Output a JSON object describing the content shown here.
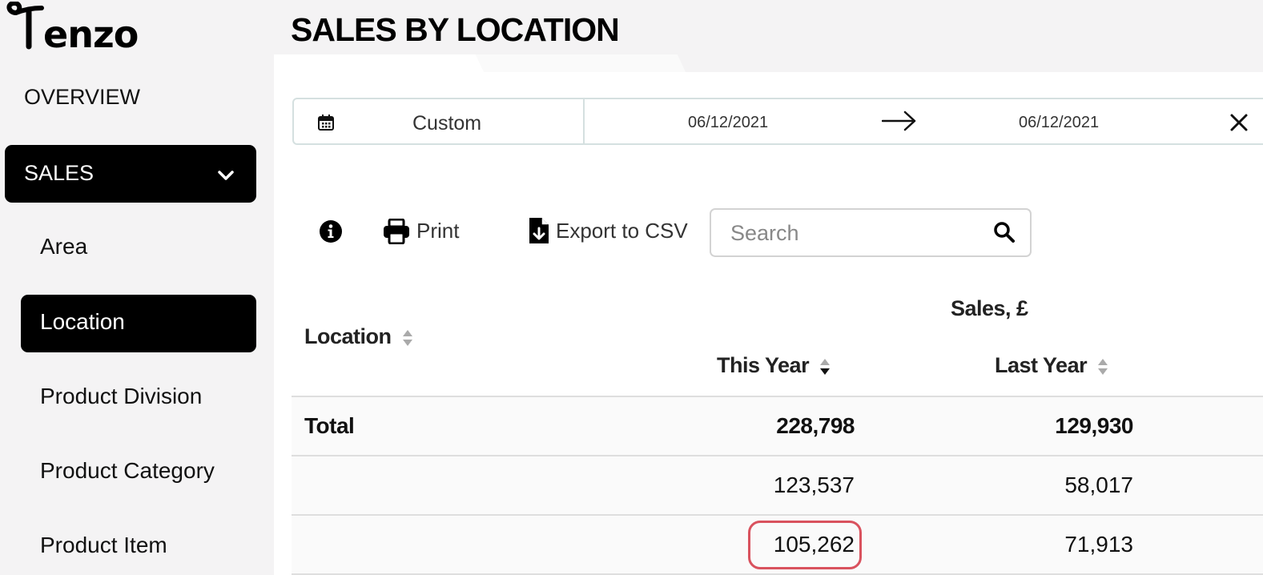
{
  "brand": {
    "logo_text": "Tenzo"
  },
  "page": {
    "title": "SALES BY LOCATION"
  },
  "sidebar": {
    "overview_label": "OVERVIEW",
    "sales_label": "SALES",
    "items": [
      {
        "label": "Area"
      },
      {
        "label": "Location",
        "active": true
      },
      {
        "label": "Product Division"
      },
      {
        "label": "Product Category"
      },
      {
        "label": "Product Item"
      }
    ]
  },
  "date_filter": {
    "preset": "Custom",
    "from": "06/12/2021",
    "to": "06/12/2021",
    "icons": [
      "calendar-icon",
      "arrow-right-icon",
      "close-icon"
    ]
  },
  "toolbar": {
    "print_label": "Print",
    "export_label": "Export to CSV",
    "search_placeholder": "Search",
    "icons": [
      "info-icon",
      "printer-icon",
      "file-download-icon",
      "search-icon"
    ]
  },
  "table": {
    "group_header": "Sales, £",
    "columns": {
      "location": "Location",
      "this_year": "This Year",
      "last_year": "Last Year"
    },
    "rows": [
      {
        "location": "Total",
        "this_year": "228,798",
        "last_year": "129,930"
      },
      {
        "location": "",
        "this_year": "123,537",
        "last_year": "58,017"
      },
      {
        "location": "",
        "this_year": "105,262",
        "last_year": "71,913"
      }
    ]
  },
  "colors": {
    "accent": "#000000",
    "highlight": "#d9525e",
    "border": "#d5e0e0"
  }
}
